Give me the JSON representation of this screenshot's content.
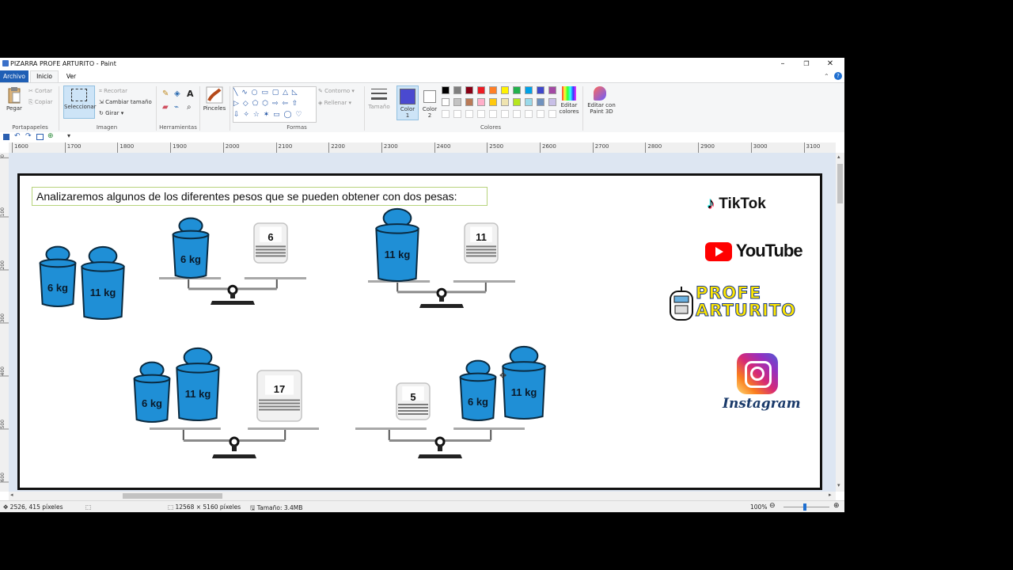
{
  "window": {
    "title": "PIZARRA PROFE ARTURITO - Paint",
    "controls": {
      "minimize": "–",
      "maximize": "❐",
      "close": "✕"
    }
  },
  "tabs": [
    {
      "label": "Archivo"
    },
    {
      "label": "Inicio"
    },
    {
      "label": "Ver"
    }
  ],
  "ribbon": {
    "clipboard": {
      "paste": "Pegar",
      "cut": "Cortar",
      "copy": "Copiar",
      "group": "Portapapeles"
    },
    "image": {
      "select": "Seleccionar",
      "crop": "Recortar",
      "resize": "Cambiar tamaño",
      "rotate": "Girar",
      "group": "Imagen"
    },
    "tools": {
      "group": "Herramientas",
      "text_glyph": "A"
    },
    "brushes": {
      "label": "Pinceles"
    },
    "shapes": {
      "outline": "Contorno",
      "fill": "Rellenar",
      "group": "Formas"
    },
    "size": {
      "label": "Tamaño"
    },
    "color1": {
      "label": "Color 1",
      "value": "#4a4ad0"
    },
    "color2": {
      "label": "Color 2",
      "value": "#ffffff"
    },
    "palette": [
      "#000000",
      "#7f7f7f",
      "#880015",
      "#ed1c24",
      "#ff7f27",
      "#fff200",
      "#22b14c",
      "#00a2e8",
      "#3f48cc",
      "#a349a4",
      "#ffffff",
      "#c3c3c3",
      "#b97a57",
      "#ffaec9",
      "#ffc90e",
      "#efe4b0",
      "#b5e61d",
      "#99d9ea",
      "#7092be",
      "#c8bfe7"
    ],
    "colors_group": "Colores",
    "edit_colors": "Editar colores",
    "paint3d": "Editar con Paint 3D"
  },
  "ruler": {
    "h_ticks": [
      "1600",
      "1700",
      "1800",
      "1900",
      "2000",
      "2100",
      "2200",
      "2300",
      "2400",
      "2500",
      "2600",
      "2700",
      "2800",
      "2900",
      "3000",
      "3100"
    ],
    "v_ticks": [
      "0",
      "100",
      "200",
      "300",
      "400",
      "500",
      "600"
    ]
  },
  "canvas": {
    "prompt": "Analizaremos algunos de los diferentes pesos que se pueden obtener con dos pesas:",
    "weight_small": "6 kg",
    "weight_big": "11 kg",
    "bags": [
      "6",
      "11",
      "17",
      "5"
    ],
    "social": {
      "tiktok": "TikTok",
      "youtube": "YouTube",
      "profe": "PROFE",
      "arturito": "ARTURITO",
      "instagram": "Instagram"
    },
    "colors": {
      "weight": "#1f8fd6",
      "weight_stroke": "#0a2a40",
      "brand_yellow": "#ffe600",
      "brand_blue": "#1a5ab8"
    }
  },
  "status": {
    "cursor_pos": "2526, 415 píxeles",
    "dimensions": "12568 × 5160 píxeles",
    "file_size": "Tamaño: 3.4MB",
    "zoom": "100%"
  }
}
